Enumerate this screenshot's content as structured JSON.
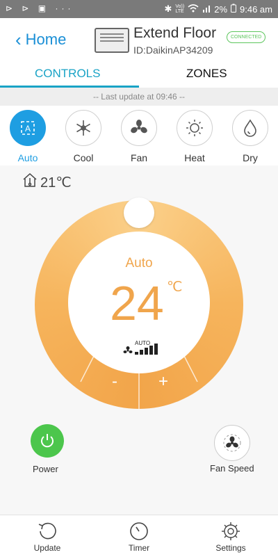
{
  "status_bar": {
    "left_icons": "⊳ ⊳ ▣ ···",
    "battery": "2%",
    "time": "9:46 am",
    "volte": "Vo))",
    "lte": "LTE"
  },
  "header": {
    "back_label": "Home",
    "device_name": "Extend Floor",
    "device_id": "ID:DaikinAP34209",
    "connection_status": "CONNECTED"
  },
  "tabs": [
    {
      "label": "CONTROLS",
      "active": true
    },
    {
      "label": "ZONES",
      "active": false
    }
  ],
  "update_text": "-- Last update at 09:46 --",
  "modes": [
    {
      "label": "Auto",
      "icon": "auto-mode-icon",
      "active": true
    },
    {
      "label": "Cool",
      "icon": "snowflake-icon",
      "active": false
    },
    {
      "label": "Fan",
      "icon": "fan-icon",
      "active": false
    },
    {
      "label": "Heat",
      "icon": "sun-icon",
      "active": false
    },
    {
      "label": "Dry",
      "icon": "droplet-icon",
      "active": false
    }
  ],
  "room_temp": "21℃",
  "dial": {
    "mode": "Auto",
    "set_temp": "24",
    "unit": "℃",
    "fan_level": "AUTO",
    "decrease_label": "-",
    "increase_label": "+"
  },
  "power_label": "Power",
  "fan_speed_label": "Fan Speed",
  "bottom_nav": [
    {
      "label": "Update",
      "icon": "refresh-icon"
    },
    {
      "label": "Timer",
      "icon": "timer-icon"
    },
    {
      "label": "Settings",
      "icon": "gear-icon"
    }
  ],
  "colors": {
    "accent": "#1e9ee2",
    "tab_accent": "#19a3c6",
    "dial_orange": "#f2a54a",
    "power_green": "#4cc64c"
  }
}
